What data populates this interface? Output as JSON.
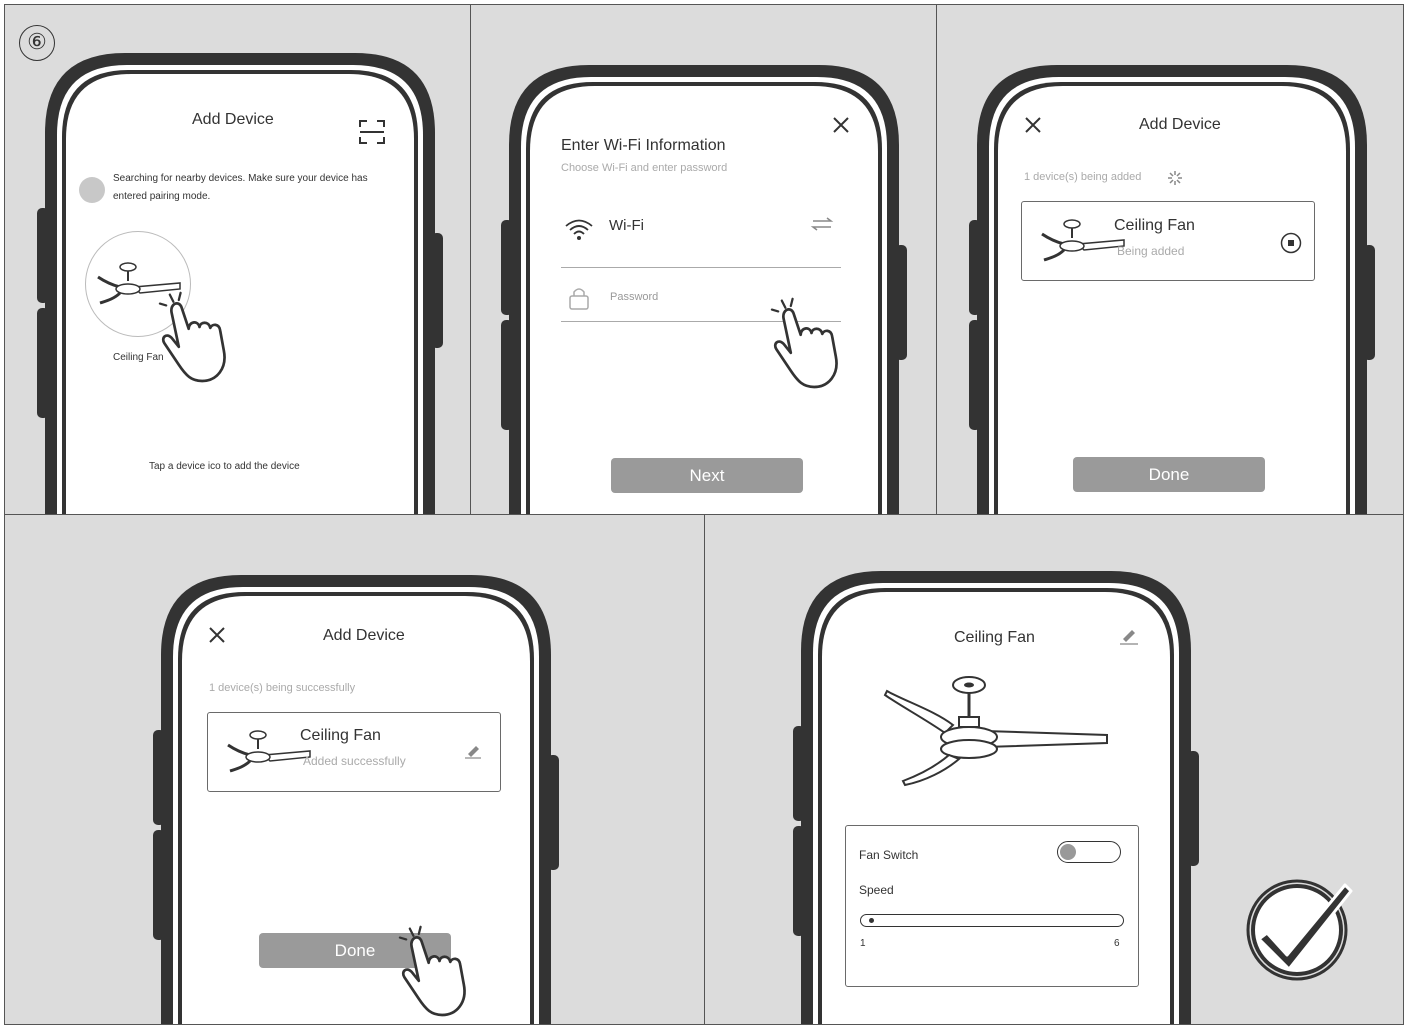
{
  "step_marker": "⑥",
  "panel1": {
    "title": "Add Device",
    "search_text_line1": "Searching for nearby devices. Make sure your device has",
    "search_text_line2": "entered pairing mode.",
    "device_label": "Ceiling Fan",
    "hint": "Tap a device ico to add the device",
    "icons": [
      "scan-icon",
      "fan-icon",
      "tap-hand-icon"
    ]
  },
  "panel2": {
    "title": "Enter Wi-Fi Information",
    "subtitle": "Choose Wi-Fi and enter password",
    "wifi_label": "Wi-Fi",
    "password_placeholder": "Password",
    "next_label": "Next",
    "icons": [
      "close-icon",
      "wifi-icon",
      "swap-icon",
      "lock-icon",
      "tap-hand-icon"
    ]
  },
  "panel3": {
    "title": "Add Device",
    "status": "1 device(s) being added",
    "device_name": "Ceiling Fan",
    "device_status": "Being added",
    "done_label": "Done",
    "icons": [
      "close-icon",
      "spinner-icon",
      "fan-icon",
      "stop-icon"
    ]
  },
  "panel4": {
    "title": "Add Device",
    "status": "1 device(s) being successfully",
    "device_name": "Ceiling Fan",
    "device_status": "Added successfully",
    "done_label": "Done",
    "icons": [
      "close-icon",
      "fan-icon",
      "edit-icon",
      "tap-hand-icon"
    ]
  },
  "panel5": {
    "title": "Ceiling Fan",
    "fan_switch_label": "Fan Switch",
    "fan_switch_on": false,
    "speed_label": "Speed",
    "speed_min": "1",
    "speed_max": "6",
    "speed_value": 1,
    "icons": [
      "edit-icon",
      "fan-icon",
      "check-icon"
    ]
  },
  "colors": {
    "panel_bg": "#dcdcdc",
    "button": "#9a9a9a",
    "frame": "#333333"
  }
}
